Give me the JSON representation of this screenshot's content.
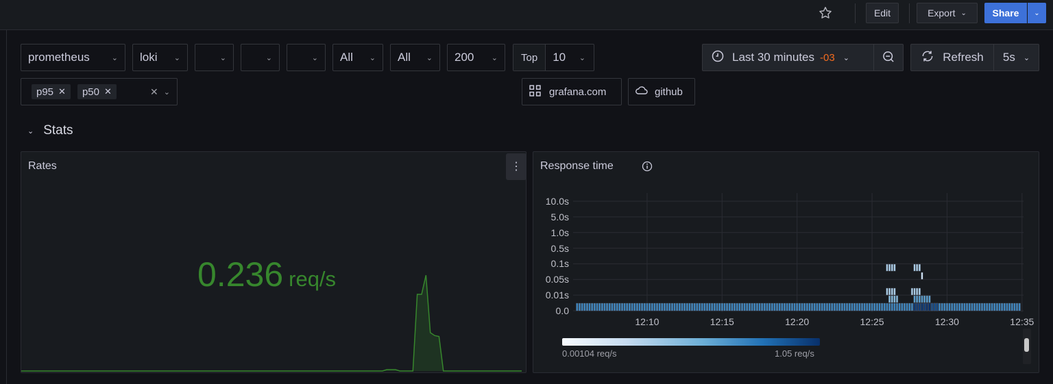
{
  "topbar": {
    "edit": "Edit",
    "export": "Export",
    "share": "Share"
  },
  "filters": {
    "datasource": "prometheus",
    "logs": "loki",
    "empty1": "",
    "empty2": "",
    "empty3": "",
    "all1": "All",
    "all2": "All",
    "status": "200",
    "top_label": "Top",
    "top_value": "10",
    "percentiles": [
      "p95",
      "p50"
    ]
  },
  "links": [
    {
      "label": "grafana.com",
      "icon": "apps-icon"
    },
    {
      "label": "github",
      "icon": "cloud-icon"
    }
  ],
  "time": {
    "range": "Last 30 minutes",
    "offset": "-03",
    "refresh": "Refresh",
    "interval": "5s"
  },
  "row": {
    "title": "Stats"
  },
  "rates": {
    "title": "Rates",
    "value": "0.236",
    "unit": "req/s",
    "color": "#37872d",
    "sparkline": [
      0,
      0,
      0,
      0,
      0,
      0,
      0,
      0,
      0,
      0,
      0,
      0,
      0,
      0,
      0,
      0,
      0,
      0,
      0,
      0,
      0,
      0,
      0,
      0,
      0,
      0,
      0,
      0,
      0,
      0,
      0,
      0,
      0,
      0,
      0,
      0,
      0,
      0,
      0,
      0,
      0,
      0,
      0,
      0,
      0,
      0,
      0,
      0,
      0,
      0,
      0,
      0,
      0,
      0,
      0,
      0,
      0,
      0,
      0,
      0,
      0,
      0,
      0,
      0,
      0,
      0,
      0,
      0,
      0,
      0,
      0,
      0,
      0,
      0,
      0,
      0,
      0,
      0,
      0,
      0,
      0,
      0,
      0,
      0,
      0.014,
      0.014,
      0.014,
      0,
      0,
      0,
      0,
      0.8,
      0.8,
      1.0,
      0.4,
      0.37,
      0.36,
      0,
      0,
      0,
      0,
      0,
      0,
      0,
      0,
      0,
      0,
      0,
      0,
      0,
      0,
      0,
      0,
      0,
      0,
      0
    ]
  },
  "response": {
    "title": "Response time",
    "yticks": [
      "0.0",
      "0.01s",
      "0.05s",
      "0.1s",
      "0.5s",
      "1.0s",
      "5.0s",
      "10.0s"
    ],
    "xticks": [
      "12:10",
      "12:15",
      "12:20",
      "12:25",
      "12:30",
      "12:35"
    ],
    "legend_min": "0.00104 req/s",
    "legend_max": "1.05 req/s"
  },
  "chart_data": {
    "type": "heatmap",
    "title": "Response time",
    "x_range": [
      "12:05:15",
      "12:35:00"
    ],
    "bucket_seconds": 10,
    "yticks": [
      "0.0",
      "0.01s",
      "0.05s",
      "0.1s",
      "0.5s",
      "1.0s",
      "5.0s",
      "10.0s"
    ],
    "color_scale": {
      "min": 0.00104,
      "max": 1.05,
      "unit": "req/s"
    },
    "cells": [
      {
        "bucket": "0-0.005s",
        "from": 0,
        "to": 178,
        "value": 0.1
      },
      {
        "bucket": "0-0.005s",
        "from": 135,
        "to": 140,
        "value": 0.8
      },
      {
        "bucket": "0-0.005s",
        "from": 140,
        "to": 142,
        "value": 1.05
      },
      {
        "bucket": "0-0.005s",
        "from": 142,
        "to": 145,
        "value": 0.5
      },
      {
        "bucket": "0.005-0.01s",
        "from": 125,
        "to": 129,
        "value": 0.02
      },
      {
        "bucket": "0.005-0.01s",
        "from": 135,
        "to": 142,
        "value": 0.05
      },
      {
        "bucket": "0.01-0.02s",
        "from": 124,
        "to": 128,
        "value": 0.01
      },
      {
        "bucket": "0.01-0.02s",
        "from": 134,
        "to": 138,
        "value": 0.01
      },
      {
        "bucket": "0.05-0.1s",
        "from": 138,
        "to": 139,
        "value": 0.005
      },
      {
        "bucket": "0.1-0.2s",
        "from": 124,
        "to": 128,
        "value": 0.01
      },
      {
        "bucket": "0.1-0.2s",
        "from": 135,
        "to": 138,
        "value": 0.01
      }
    ]
  }
}
